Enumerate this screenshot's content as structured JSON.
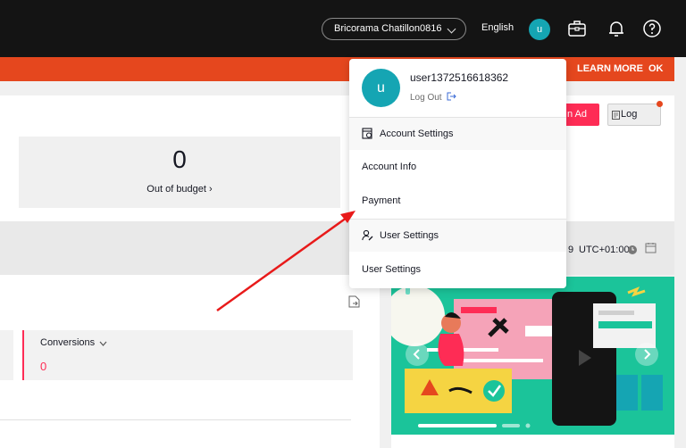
{
  "topbar": {
    "account_name": "Bricorama Chatillon0816",
    "language": "English",
    "avatar_letter": "u"
  },
  "banner": {
    "learn_more": "LEARN MORE",
    "ok": "OK"
  },
  "overview": {
    "stat_value": "0",
    "stat_label": "Out of budget ›",
    "create_ad_label": "n Ad",
    "log_label": "Log"
  },
  "date_range": {
    "date_fragment": "9",
    "timezone": "UTC+01:00"
  },
  "metrics": {
    "conversions_label": "Conversions",
    "conversions_value": "0"
  },
  "dropdown": {
    "avatar_letter": "u",
    "username": "user1372516618362",
    "logout": "Log Out",
    "account_settings_header": "Account Settings",
    "account_info": "Account Info",
    "payment": "Payment",
    "user_settings_header": "User Settings",
    "user_settings_item": "User Settings"
  },
  "colors": {
    "accent": "#fe2c55",
    "banner": "#e5471e",
    "avatar": "#15a5b3",
    "topbar": "#141414",
    "promo": "#1bc49a"
  },
  "icons": [
    "chevron-down-icon",
    "briefcase-icon",
    "bell-icon",
    "help-icon",
    "logout-icon",
    "account-settings-icon",
    "user-settings-icon",
    "log-icon",
    "clock-icon",
    "calendar-icon",
    "export-icon"
  ]
}
